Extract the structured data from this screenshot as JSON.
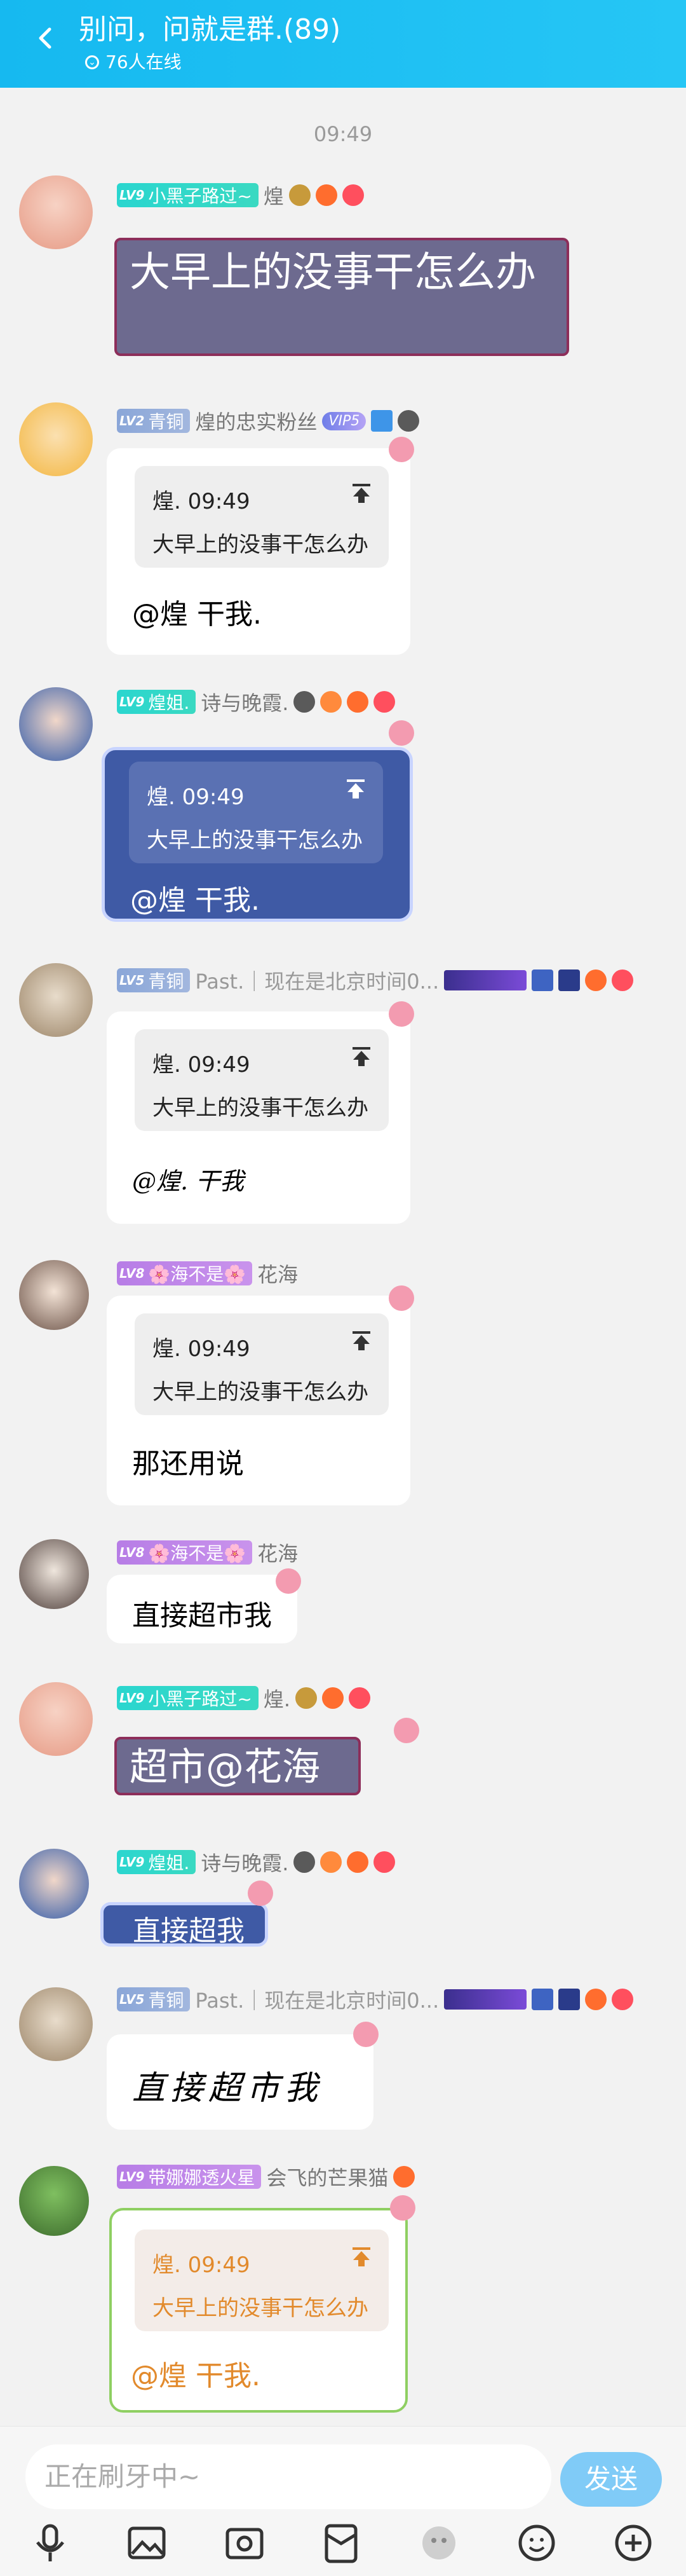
{
  "header": {
    "title": "别问，问就是群.(89)",
    "online": "76人在线"
  },
  "time": "09:49",
  "messages": [
    {
      "id": "m1",
      "level": "LV9",
      "badge_name": "小黑子路过~",
      "sender": "煌",
      "text": "大早上的没事干怎么办"
    },
    {
      "id": "m2",
      "level": "LV2",
      "badge_name": "青铜",
      "sender": "煌的忠实粉丝",
      "vip": "VIP5",
      "quote_header": "煌. 09:49",
      "quote_text": "大早上的没事干怎么办",
      "text": "@煌 干我."
    },
    {
      "id": "m3",
      "level": "LV9",
      "badge_name": "煌姐.",
      "sender": "诗与晚霞.",
      "quote_header": "煌. 09:49",
      "quote_text": "大早上的没事干怎么办",
      "text": "@煌 干我."
    },
    {
      "id": "m4",
      "level": "LV5",
      "badge_name": "青铜",
      "sender": "Past.｜现在是北京时间0...",
      "quote_header": "煌. 09:49",
      "quote_text": "大早上的没事干怎么办",
      "text": "@煌. 干我"
    },
    {
      "id": "m5",
      "level": "LV8",
      "badge_name": "🌸海不是🌸",
      "sender": "花海",
      "quote_header": "煌. 09:49",
      "quote_text": "大早上的没事干怎么办",
      "text": "那还用说"
    },
    {
      "id": "m6",
      "level": "LV8",
      "badge_name": "🌸海不是🌸",
      "sender": "花海",
      "text": "直接超市我"
    },
    {
      "id": "m7",
      "level": "LV9",
      "badge_name": "小黑子路过~",
      "sender": "煌.",
      "text": "超市@花海"
    },
    {
      "id": "m8",
      "level": "LV9",
      "badge_name": "煌姐.",
      "sender": "诗与晚霞.",
      "text": "直接超我"
    },
    {
      "id": "m9",
      "level": "LV5",
      "badge_name": "青铜",
      "sender": "Past.｜现在是北京时间0...",
      "text": "直接超市我"
    },
    {
      "id": "m10",
      "level": "LV9",
      "badge_name": "带娜娜透火星",
      "sender": "会飞的芒果猫",
      "quote_header": "煌. 09:49",
      "quote_text": "大早上的没事干怎么办",
      "text": "@煌 干我."
    }
  ],
  "input": {
    "placeholder": "正在刷牙中~",
    "send_label": "发送"
  },
  "toolbar": [
    "microphone-icon",
    "image-icon",
    "camera-icon",
    "red-packet-icon",
    "emoji-pack-icon",
    "emoji-icon",
    "plus-icon"
  ],
  "colors": {
    "header": "#16b9f0",
    "send": "#80cbf7",
    "lv_teal": "#2ad6cf",
    "lv_blue": "#8aa6d8",
    "lv_purple": "#b77de6"
  }
}
